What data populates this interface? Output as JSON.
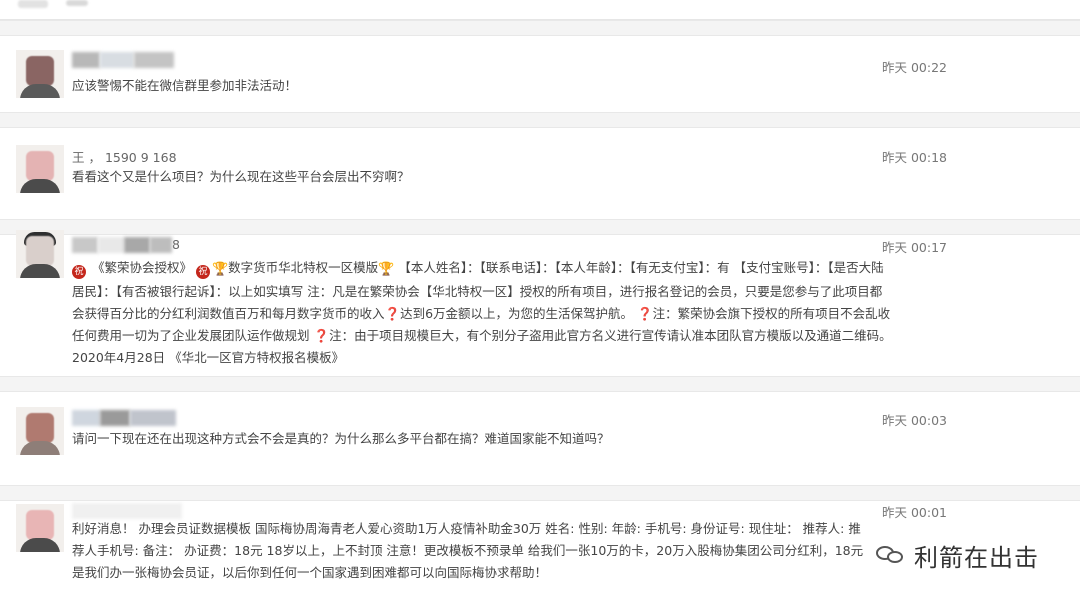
{
  "messages": [
    {
      "name_visible": "",
      "time": "昨天 00:22",
      "content": "应该警惕不能在微信群里参加非法活动！"
    },
    {
      "name_visible": "王 ， 1590 9 168",
      "time": "昨天 00:18",
      "content": "看看这个又是什么项目？为什么现在这些平台会层出不穷啊？"
    },
    {
      "name_visible": "8",
      "time": "昨天 00:17",
      "content_parts": {
        "p1": "《繁荣协会授权》",
        "p2": "数字货币华北特权一区模版",
        "p3": "【本人姓名】：【联系电话】：【本人年龄】：【有无支付宝】：有 【支付宝账号】：【是否大陆居民】：【有否被银行起诉】：以上如实填写   注：凡是在繁荣协会【华北特权一区】授权的所有项目，进行报名登记的会员，只要是您参与了此项目都会获得百分比的分红利润数值百万和每月数字货币的收入",
        "p4": "达到6万金额以上，为您的生活保驾护航。",
        "p5": "注：繁荣协会旗下授权的所有项目不会乱收任何费用一切为了企业发展团队运作做规划",
        "p6": "注：由于项目规模巨大，有个别分子盗用此官方名义进行宣传请认准本团队官方模版以及通道二维码。 2020年4月28日 《华北一区官方特权报名模板》"
      }
    },
    {
      "name_visible": "",
      "time": "昨天 00:03",
      "content": "请问一下现在还在出现这种方式会不会是真的？为什么那么多平台都在搞？难道国家能不知道吗？"
    },
    {
      "name_visible": "",
      "time": "昨天 00:01",
      "content": "利好消息！ 办理会员证数据模板 国际梅协周海青老人爱心资助1万人疫情补助金30万 姓名: 性别: 年龄: 手机号: 身份证号: 现住址： 推荐人: 推荐人手机号: 备注： 办证费：18元 18岁以上，上不封顶 注意！更改模板不预录单 给我们一张10万的卡，20万入股梅协集团公司分红利，18元是我们办一张梅协会员证，以后你到任何一个国家遇到困难都可以向国际梅协求帮助！"
    }
  ],
  "icons": {
    "stamp_char": "祝",
    "trophy": "trophy-icon",
    "question_mark": "❓"
  },
  "watermark": {
    "text": "利箭在出击",
    "icon": "wechat-icon"
  },
  "colors": {
    "separator": "#f4f4f4",
    "time": "#777777",
    "accent_red": "#c4271c"
  }
}
